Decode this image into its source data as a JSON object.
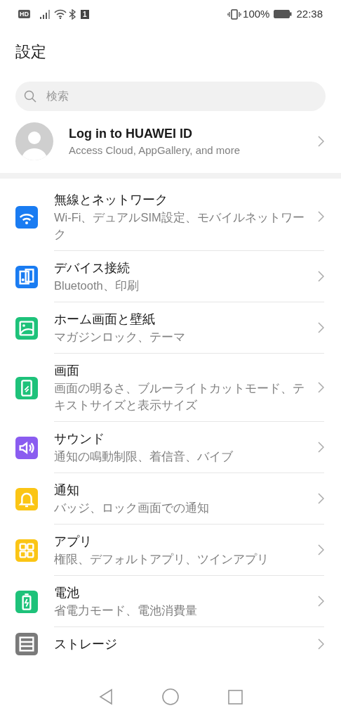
{
  "status_bar": {
    "hd_badge": "HD",
    "sim_badge": "1",
    "battery_percent": "100%",
    "time": "22:38"
  },
  "title": "設定",
  "search": {
    "placeholder": "検索"
  },
  "account": {
    "title": "Log in to HUAWEI ID",
    "subtitle": "Access Cloud, AppGallery, and more"
  },
  "settings": [
    {
      "kind": "wifi",
      "color": "#1a7cf2",
      "title": "無線とネットワーク",
      "subtitle": "Wi-Fi、デュアルSIM設定、モバイルネットワーク"
    },
    {
      "kind": "devices",
      "color": "#1a7cf2",
      "title": "デバイス接続",
      "subtitle": "Bluetooth、印刷"
    },
    {
      "kind": "image",
      "color": "#1ec27a",
      "title": "ホーム画面と壁紙",
      "subtitle": "マガジンロック、テーマ"
    },
    {
      "kind": "display",
      "color": "#1ec27a",
      "title": "画面",
      "subtitle": "画面の明るさ、ブルーライトカットモード、テキストサイズと表示サイズ"
    },
    {
      "kind": "sound",
      "color": "#8a5cf0",
      "title": "サウンド",
      "subtitle": "通知の鳴動制限、着信音、バイブ"
    },
    {
      "kind": "bell",
      "color": "#fbc515",
      "title": "通知",
      "subtitle": "バッジ、ロック画面での通知"
    },
    {
      "kind": "apps",
      "color": "#fbc515",
      "title": "アプリ",
      "subtitle": "権限、デフォルトアプリ、ツインアプリ"
    },
    {
      "kind": "battery",
      "color": "#1ec27a",
      "title": "電池",
      "subtitle": "省電力モード、電池消費量"
    },
    {
      "kind": "storage",
      "color": "#7a7a7a",
      "title": "ストレージ"
    }
  ]
}
